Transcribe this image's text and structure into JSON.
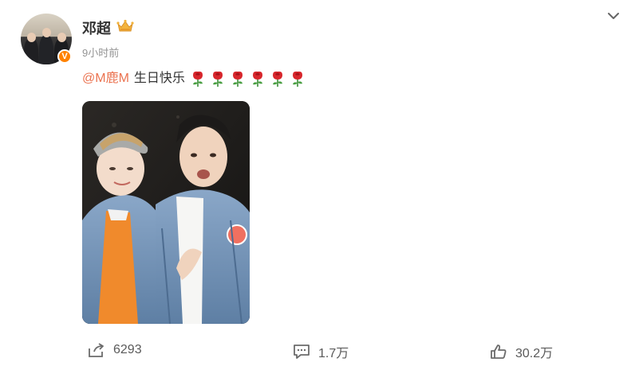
{
  "post": {
    "author": "邓超",
    "time": "9小时前",
    "mention": "@M鹿M",
    "text": "生日快乐",
    "rose_count": 6,
    "verified_badge": "V"
  },
  "actions": {
    "share_count": "6293",
    "comment_count": "1.7万",
    "like_count": "30.2万"
  },
  "icons": {
    "header": [
      "crown-icon",
      "chevron-down-icon",
      "verified-icon"
    ],
    "inline": [
      "rose-icon"
    ],
    "actions": [
      "share-icon",
      "comment-icon",
      "thumbs-up-icon"
    ]
  },
  "colors": {
    "mention": "#eb7350",
    "muted": "#939393",
    "badge": "#ff8200",
    "text": "#333333"
  }
}
